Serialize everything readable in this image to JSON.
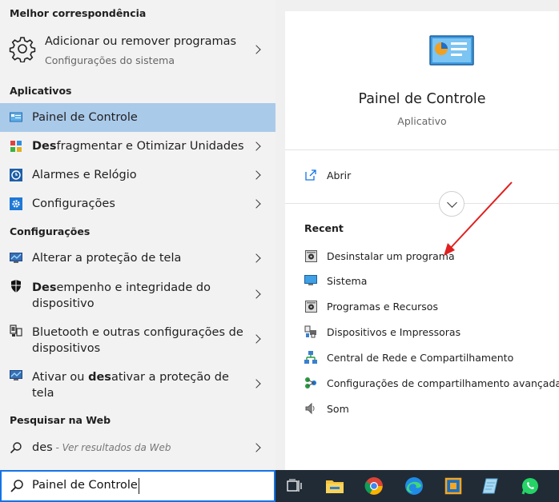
{
  "left": {
    "best_match_header": "Melhor correspondência",
    "best_match": {
      "title": "Adicionar ou remover programas",
      "subtitle": "Configurações do sistema",
      "icon": "gear-icon"
    },
    "apps_header": "Aplicativos",
    "apps": [
      {
        "label": "Painel de Controle",
        "icon": "control-panel-icon",
        "selected": true
      },
      {
        "label_bold": "Des",
        "label_rest": "fragmentar e Otimizar Unidades",
        "icon": "defrag-icon"
      },
      {
        "label": "Alarmes e Relógio",
        "icon": "alarm-clock-icon"
      },
      {
        "label": "Configurações",
        "icon": "settings-gear-icon"
      }
    ],
    "settings_header": "Configurações",
    "settings": [
      {
        "label": "Alterar a proteção de tela",
        "icon": "screensaver-icon"
      },
      {
        "label_bold": "Des",
        "label_rest_line1": "empenho e integridade do",
        "label_line2": "dispositivo",
        "icon": "shield-icon"
      },
      {
        "label_line1": "Bluetooth e outras configurações de",
        "label_line2": "dispositivos",
        "icon": "devices-icon"
      },
      {
        "label_pre": "Ativar ou ",
        "label_bold": "des",
        "label_rest_line1": "ativar a proteção de",
        "label_line2": "tela",
        "icon": "screensaver-icon"
      }
    ],
    "web_header": "Pesquisar na Web",
    "web": {
      "query": "des",
      "suffix": " - Ver resultados da Web",
      "icon": "search-icon"
    }
  },
  "right": {
    "title": "Painel de Controle",
    "subtitle": "Aplicativo",
    "open_label": "Abrir",
    "recent_header": "Recent",
    "recent": [
      {
        "label": "Desinstalar um programa",
        "icon": "programs-icon"
      },
      {
        "label": "Sistema",
        "icon": "monitor-icon"
      },
      {
        "label": "Programas e Recursos",
        "icon": "programs-icon"
      },
      {
        "label": "Dispositivos e Impressoras",
        "icon": "printer-icon"
      },
      {
        "label": "Central de Rede e Compartilhamento",
        "icon": "network-icon"
      },
      {
        "label": "Configurações de compartilhamento avançadas",
        "icon": "sharing-icon"
      },
      {
        "label": "Som",
        "icon": "speaker-icon"
      }
    ]
  },
  "search": {
    "value": "Painel de Controle"
  },
  "taskbar": {
    "icons": [
      "task-view-icon",
      "file-explorer-icon",
      "chrome-icon",
      "edge-icon",
      "virtualbox-icon",
      "notepad-icon",
      "whatsapp-icon"
    ]
  },
  "colors": {
    "selected": "#aacaea",
    "accent": "#1473e6",
    "annotation_arrow": "#e02020",
    "taskbar": "#202b36"
  }
}
